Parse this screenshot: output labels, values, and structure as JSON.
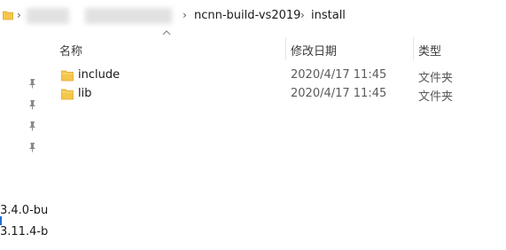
{
  "breadcrumb": {
    "segments": [
      "ncnn-build-vs2019",
      "install"
    ],
    "separator": "›"
  },
  "columns": {
    "name": "名称",
    "modified": "修改日期",
    "type": "类型"
  },
  "files": [
    {
      "name": "include",
      "modified": "2020/4/17 11:45",
      "type": "文件夹",
      "icon": "folder-icon"
    },
    {
      "name": "lib",
      "modified": "2020/4/17 11:45",
      "type": "文件夹",
      "icon": "folder-icon"
    }
  ],
  "nav": {
    "pinned_count": 4,
    "items": [
      "3.4.0-bu",
      "3.11.4-b"
    ]
  },
  "colors": {
    "folder": "#f4c64a",
    "folder_dark": "#e4a92a",
    "accent": "#1f6fd1"
  }
}
